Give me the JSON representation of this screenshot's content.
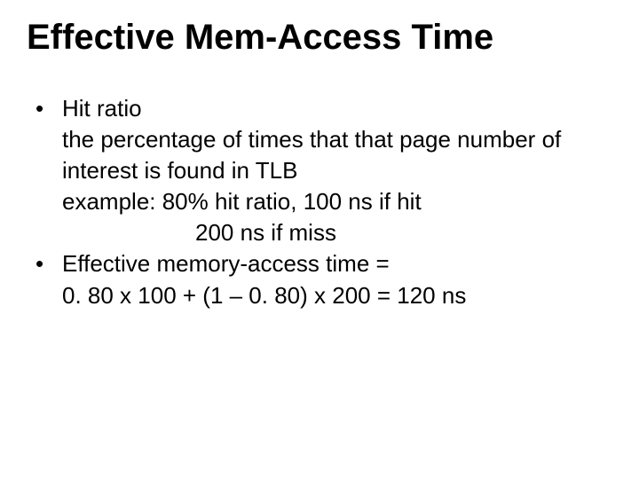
{
  "title": "Effective Mem-Access Time",
  "bullet1": {
    "label": "Hit ratio",
    "line1": "the percentage of times that that page number of interest is found in TLB",
    "line2": "example: 80% hit ratio, 100 ns if hit",
    "line3": "200 ns if miss"
  },
  "bullet2": {
    "label": "Effective memory-access time =",
    "line1": "0. 80 x 100 + (1 – 0. 80) x 200 = 120 ns"
  },
  "bullet_char": "•"
}
